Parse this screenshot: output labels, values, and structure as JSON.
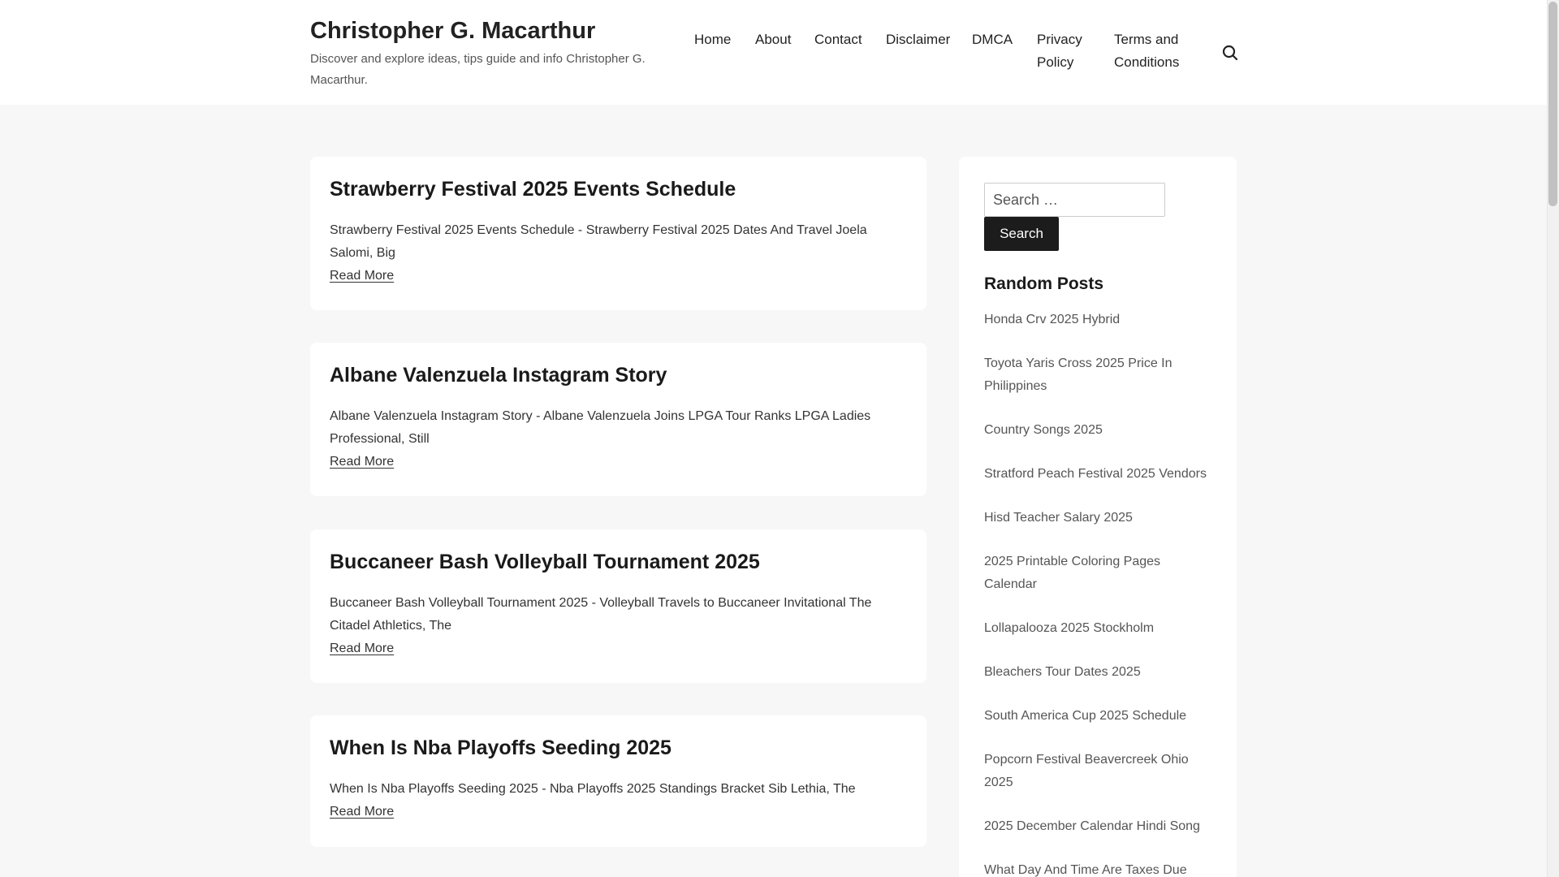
{
  "site": {
    "title": "Christopher G. Macarthur",
    "description": "Discover and explore ideas, tips guide and info Christopher G. Macarthur."
  },
  "nav": {
    "items": [
      "Home",
      "About",
      "Contact",
      "Disclaimer",
      "DMCA",
      "Privacy Policy",
      "Terms and Conditions"
    ],
    "search_icon": "search-icon"
  },
  "posts": [
    {
      "title": "Strawberry Festival 2025 Events Schedule",
      "excerpt": "Strawberry Festival 2025 Events Schedule - Strawberry Festival 2025 Dates And Travel Joela Salomi, Big",
      "read_more": "Read More"
    },
    {
      "title": "Albane Valenzuela Instagram Story",
      "excerpt": "Albane Valenzuela Instagram Story - Albane Valenzuela Joins LPGA Tour Ranks LPGA Ladies Professional, Still",
      "read_more": "Read More"
    },
    {
      "title": "Buccaneer Bash Volleyball Tournament 2025",
      "excerpt": "Buccaneer Bash Volleyball Tournament 2025 - Volleyball Travels to Buccaneer Invitational The Citadel Athletics, The",
      "read_more": "Read More"
    },
    {
      "title": "When Is Nba Playoffs Seeding 2025",
      "excerpt": "When Is Nba Playoffs Seeding 2025 - Nba Playoffs 2025 Standings Bracket Sib Lethia, The",
      "read_more": "Read More"
    }
  ],
  "sidebar": {
    "search_placeholder": "Search …",
    "search_button": "Search",
    "random_title": "Random Posts",
    "random_posts": [
      "Honda Crv 2025 Hybrid",
      "Toyota Yaris Cross 2025 Price In Philippines",
      "Country Songs 2025",
      "Stratford Peach Festival 2025 Vendors",
      "Hisd Teacher Salary 2025",
      "2025 Printable Coloring Pages Calendar",
      "Lollapalooza 2025 Stockholm",
      "Bleachers Tour Dates 2025",
      "South America Cup 2025 Schedule",
      "Popcorn Festival Beavercreek Ohio 2025",
      "2025 December Calendar Hindi Song",
      "What Day And Time Are Taxes Due"
    ]
  },
  "colors": {
    "background": "#f7f7f7",
    "card": "#ffffff",
    "button": "#1c1c1c"
  }
}
